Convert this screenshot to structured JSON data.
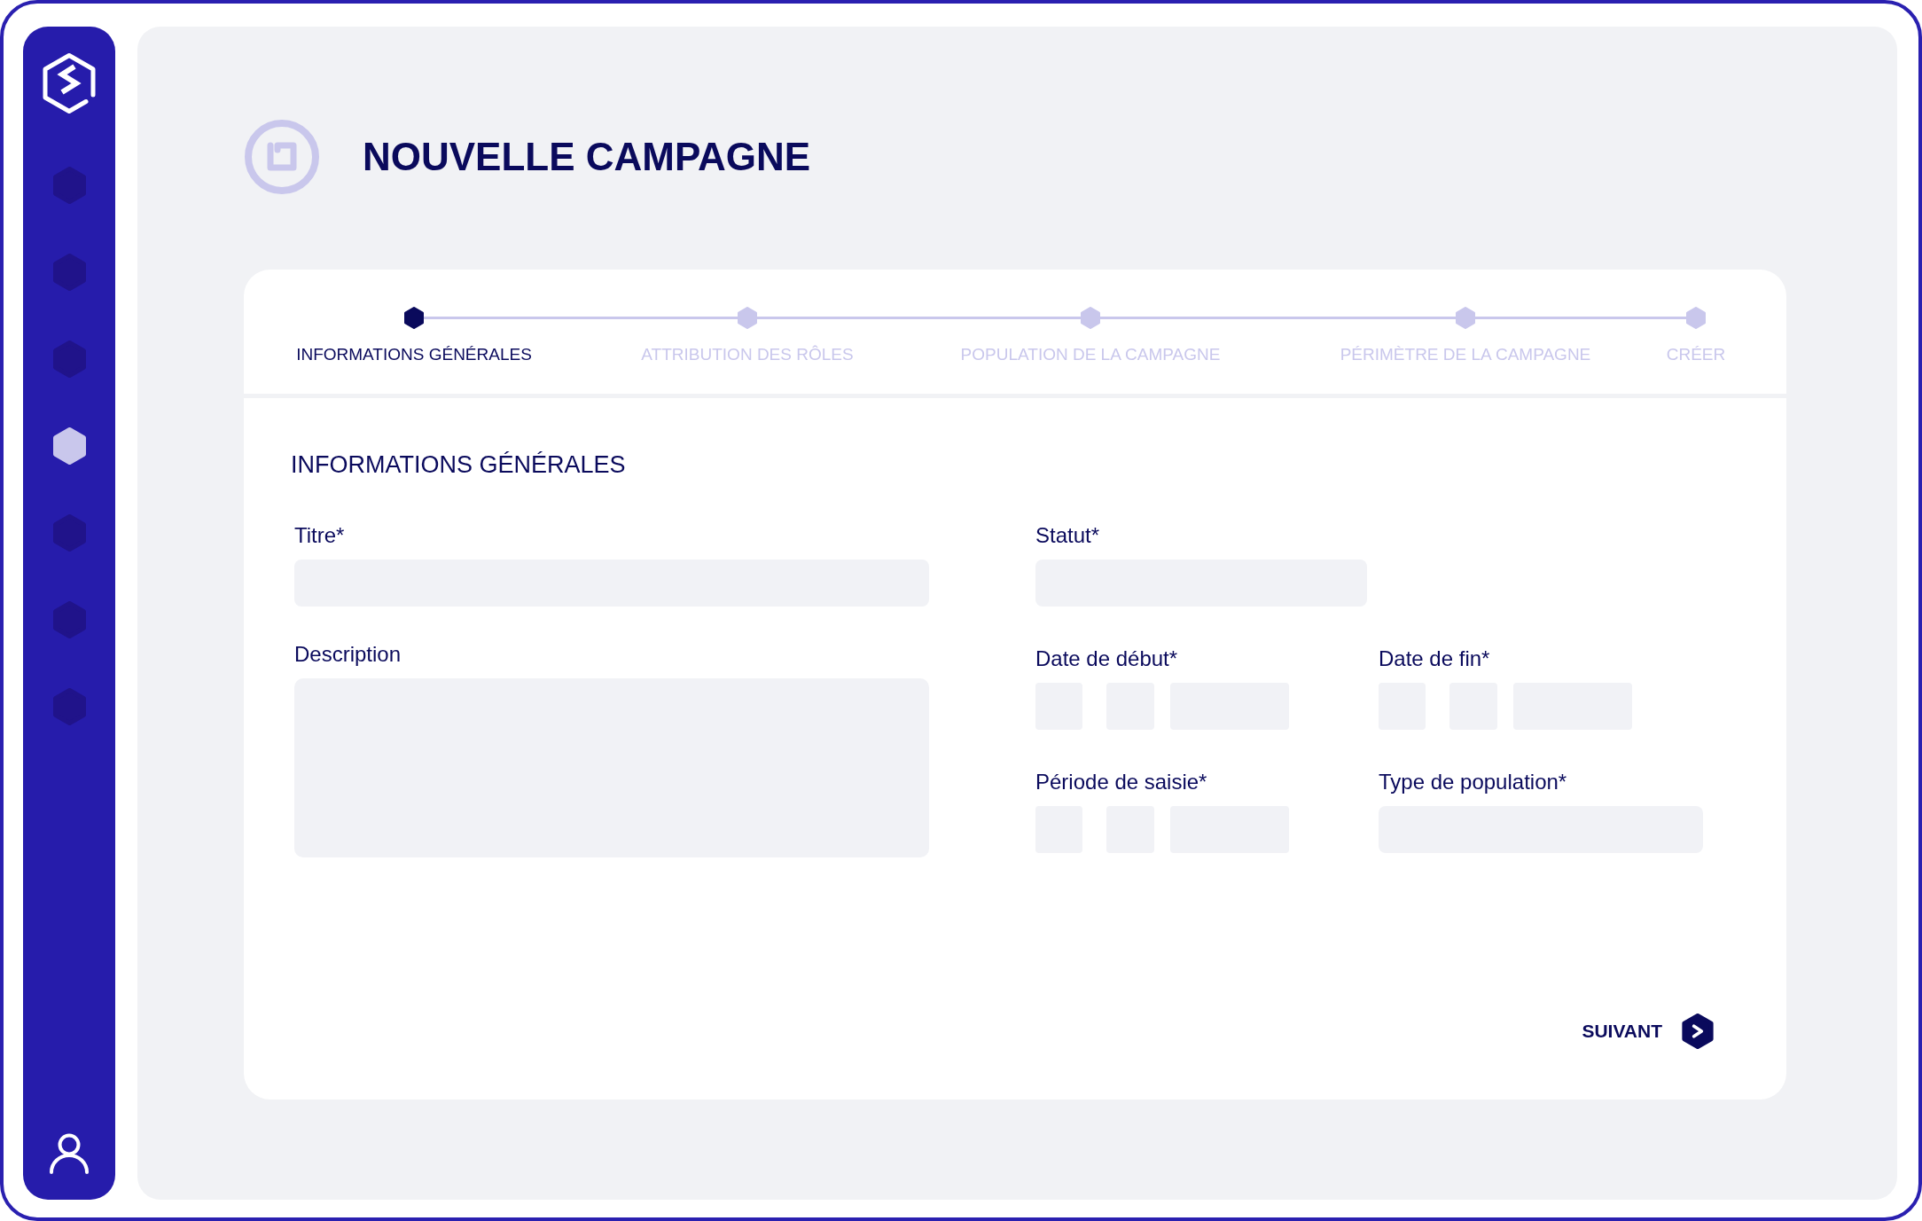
{
  "sidebar": {
    "items": [
      {
        "selected": false
      },
      {
        "selected": false
      },
      {
        "selected": false
      },
      {
        "selected": true
      },
      {
        "selected": false
      },
      {
        "selected": false
      },
      {
        "selected": false
      }
    ]
  },
  "header": {
    "title": "NOUVELLE CAMPAGNE"
  },
  "stepper": {
    "steps": [
      {
        "label": "INFORMATIONS GÉNÉRALES",
        "selected": true
      },
      {
        "label": "ATTRIBUTION DES RÔLES",
        "selected": false
      },
      {
        "label": "POPULATION DE LA CAMPAGNE",
        "selected": false
      },
      {
        "label": "PÉRIMÈTRE DE LA CAMPAGNE",
        "selected": false
      },
      {
        "label": "CRÉER",
        "selected": false
      }
    ]
  },
  "form": {
    "title": "INFORMATIONS GÉNÉRALES",
    "left_fields": [
      {
        "label": "Titre*",
        "kind": "text"
      },
      {
        "label": "Description",
        "kind": "textarea"
      }
    ],
    "right_rows": [
      [
        {
          "label": "Statut*",
          "kind": "text"
        }
      ],
      [
        {
          "label": "Date de début*",
          "kind": "date"
        },
        {
          "label": "Date de fin*",
          "kind": "date"
        }
      ],
      [
        {
          "label": "Période de saisie*",
          "kind": "date"
        },
        {
          "label": "Type de population*",
          "kind": "text"
        }
      ]
    ]
  },
  "next_button": {
    "label": "SUIVANT"
  }
}
